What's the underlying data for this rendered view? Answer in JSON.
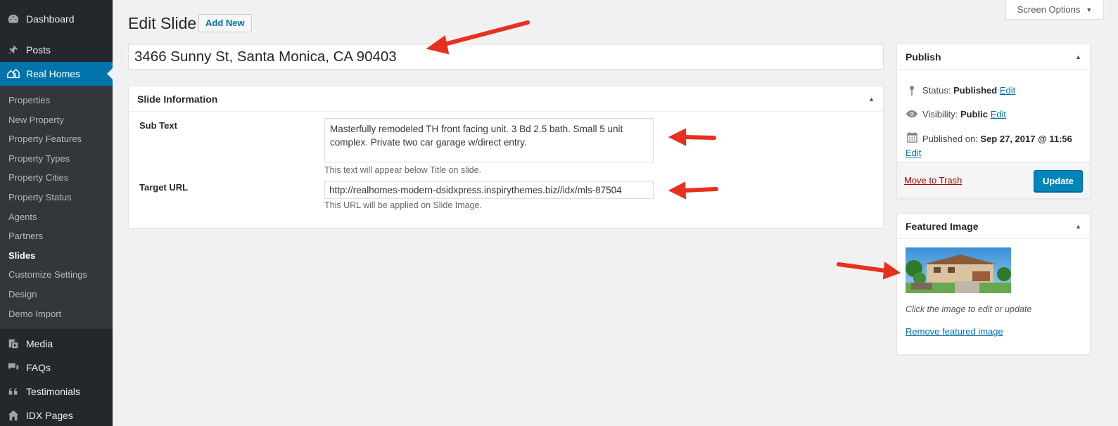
{
  "sidebar": {
    "top": [
      {
        "label": "Dashboard",
        "icon": "dashboard-icon"
      },
      {
        "label": "Posts",
        "icon": "pin-icon"
      }
    ],
    "active": {
      "label": "Real Homes",
      "icon": "houses-icon"
    },
    "submenu": [
      "Properties",
      "New Property",
      "Property Features",
      "Property Types",
      "Property Cities",
      "Property Status",
      "Agents",
      "Partners",
      "Slides",
      "Customize Settings",
      "Design",
      "Demo Import"
    ],
    "current_submenu": "Slides",
    "bottom": [
      {
        "label": "Media",
        "icon": "media-icon"
      },
      {
        "label": "FAQs",
        "icon": "chat-icon"
      },
      {
        "label": "Testimonials",
        "icon": "quote-icon"
      },
      {
        "label": "IDX Pages",
        "icon": "home-icon"
      }
    ]
  },
  "header": {
    "screen_options": "Screen Options",
    "title": "Edit Slide",
    "add_new": "Add New"
  },
  "post_title": "3466 Sunny St, Santa Monica, CA 90403",
  "slide_info": {
    "heading": "Slide Information",
    "sub_text_label": "Sub Text",
    "sub_text_value": "Masterfully remodeled TH front facing unit. 3 Bd 2.5 bath. Small 5 unit complex. Private two car garage w/direct entry.",
    "sub_text_desc": "This text will appear below Title on slide.",
    "target_url_label": "Target URL",
    "target_url_value": "http://realhomes-modern-dsidxpress.inspirythemes.biz//idx/mls-87504",
    "target_url_desc": "This URL will be applied on Slide Image."
  },
  "publish": {
    "heading": "Publish",
    "status_label": "Status:",
    "status_value": "Published",
    "visibility_label": "Visibility:",
    "visibility_value": "Public",
    "published_on_label": "Published on:",
    "published_on_value": "Sep 27, 2017 @ 11:56",
    "edit": "Edit",
    "trash": "Move to Trash",
    "update": "Update"
  },
  "featured": {
    "heading": "Featured Image",
    "hint": "Click the image to edit or update",
    "remove": "Remove featured image"
  },
  "colors": {
    "sidebar_bg": "#23282d",
    "active_blue": "#0073aa",
    "update_blue": "#0085ba",
    "arrow_red": "#e8301e"
  }
}
